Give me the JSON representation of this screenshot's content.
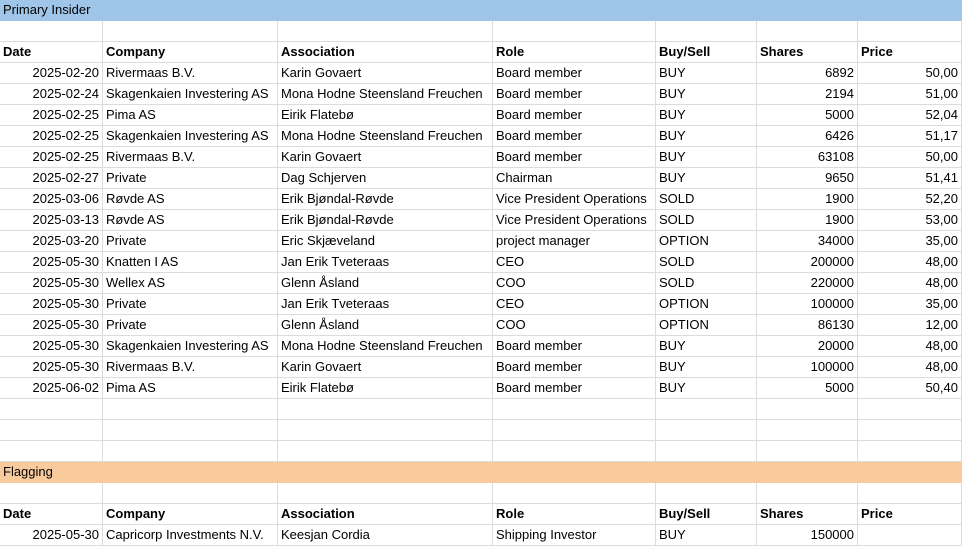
{
  "sections": {
    "primary_title": "Primary Insider",
    "flagging_title": "Flagging"
  },
  "headers": [
    "Date",
    "Company",
    "Association",
    "Role",
    "Buy/Sell",
    "Shares",
    "Price"
  ],
  "primary_rows": [
    [
      "2025-02-20",
      "Rivermaas B.V.",
      "Karin Govaert",
      "Board member",
      "BUY",
      "6892",
      "50,00"
    ],
    [
      "2025-02-24",
      "Skagenkaien Investering AS",
      "Mona Hodne Steensland Freuchen",
      "Board member",
      "BUY",
      "2194",
      "51,00"
    ],
    [
      "2025-02-25",
      "Pima AS",
      "Eirik Flatebø",
      "Board member",
      "BUY",
      "5000",
      "52,04"
    ],
    [
      "2025-02-25",
      "Skagenkaien Investering AS",
      "Mona Hodne Steensland Freuchen",
      "Board member",
      "BUY",
      "6426",
      "51,17"
    ],
    [
      "2025-02-25",
      "Rivermaas B.V.",
      "Karin Govaert",
      "Board member",
      "BUY",
      "63108",
      "50,00"
    ],
    [
      "2025-02-27",
      "Private",
      "Dag Schjerven",
      "Chairman",
      "BUY",
      "9650",
      "51,41"
    ],
    [
      "2025-03-06",
      "Røvde AS",
      "Erik Bjøndal-Røvde",
      "Vice President Operations",
      "SOLD",
      "1900",
      "52,20"
    ],
    [
      "2025-03-13",
      "Røvde AS",
      "Erik Bjøndal-Røvde",
      "Vice President Operations",
      "SOLD",
      "1900",
      "53,00"
    ],
    [
      "2025-03-20",
      "Private",
      "Eric Skjæveland",
      "project manager",
      "OPTION",
      "34000",
      "35,00"
    ],
    [
      "2025-05-30",
      "Knatten I AS",
      "Jan Erik Tveteraas",
      "CEO",
      "SOLD",
      "200000",
      "48,00"
    ],
    [
      "2025-05-30",
      "Wellex AS",
      "Glenn Åsland",
      "COO",
      "SOLD",
      "220000",
      "48,00"
    ],
    [
      "2025-05-30",
      "Private",
      "Jan Erik Tveteraas",
      "CEO",
      "OPTION",
      "100000",
      "35,00"
    ],
    [
      "2025-05-30",
      "Private",
      "Glenn Åsland",
      "COO",
      "OPTION",
      "86130",
      "12,00"
    ],
    [
      "2025-05-30",
      "Skagenkaien Investering AS",
      "Mona Hodne Steensland Freuchen",
      "Board member",
      "BUY",
      "20000",
      "48,00"
    ],
    [
      "2025-05-30",
      "Rivermaas B.V.",
      "Karin Govaert",
      "Board member",
      "BUY",
      "100000",
      "48,00"
    ],
    [
      "2025-06-02",
      "Pima AS",
      "Eirik Flatebø",
      "Board member",
      "BUY",
      "5000",
      "50,40"
    ]
  ],
  "flagging_rows": [
    [
      "2025-05-30",
      "Capricorp Investments N.V.",
      "Keesjan Cordia",
      "Shipping Investor",
      "BUY",
      "150000",
      ""
    ]
  ],
  "colors": {
    "primary_band": "#9fc5e8",
    "flagging_band": "#f9cb9c",
    "gridline": "#dadce0"
  }
}
